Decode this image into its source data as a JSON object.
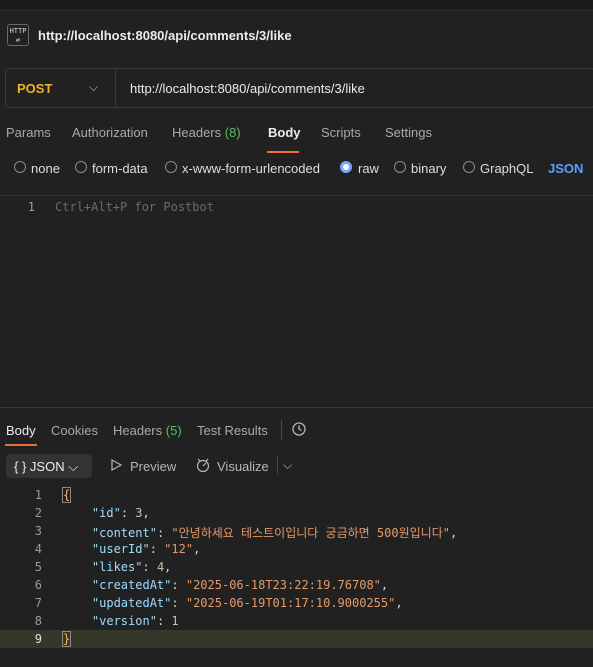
{
  "request": {
    "title": "http://localhost:8080/api/comments/3/like",
    "method": "POST",
    "url": "http://localhost:8080/api/comments/3/like",
    "icon": "http-icon"
  },
  "request_tabs": [
    {
      "label": "Params"
    },
    {
      "label": "Authorization"
    },
    {
      "label": "Headers",
      "count": "(8)"
    },
    {
      "label": "Body",
      "active": true
    },
    {
      "label": "Scripts"
    },
    {
      "label": "Settings"
    }
  ],
  "body_options": [
    "none",
    "form-data",
    "x-www-form-urlencoded",
    "raw",
    "binary",
    "GraphQL"
  ],
  "body_selected": "raw",
  "body_format": "JSON",
  "editor": {
    "line": "1",
    "placeholder": "Ctrl+Alt+P for Postbot"
  },
  "response_tabs": [
    {
      "label": "Body",
      "active": true
    },
    {
      "label": "Cookies"
    },
    {
      "label": "Headers",
      "count": "(5)"
    },
    {
      "label": "Test Results"
    }
  ],
  "response_toolbar": {
    "format": "JSON",
    "preview": "Preview",
    "visualize": "Visualize"
  },
  "response_lines": [
    "1",
    "2",
    "3",
    "4",
    "5",
    "6",
    "7",
    "8",
    "9"
  ],
  "response": {
    "open": "{",
    "close": "}",
    "id_key": "\"id\"",
    "id_val": "3",
    "content_key": "\"content\"",
    "content_val": "\"안녕하세요 테스트이입니다 궁금하면 500원입니다\"",
    "userId_key": "\"userId\"",
    "userId_val": "\"12\"",
    "likes_key": "\"likes\"",
    "likes_val": "4",
    "createdAt_key": "\"createdAt\"",
    "createdAt_val": "\"2025-06-18T23:22:19.76708\"",
    "updatedAt_key": "\"updatedAt\"",
    "updatedAt_val": "\"2025-06-19T01:17:10.9000255\"",
    "version_key": "\"version\"",
    "version_val": "1"
  },
  "colors": {
    "accent": "#f26b3a",
    "method": "#f0b429",
    "count": "#5dbb63",
    "link": "#5aa0ff"
  }
}
